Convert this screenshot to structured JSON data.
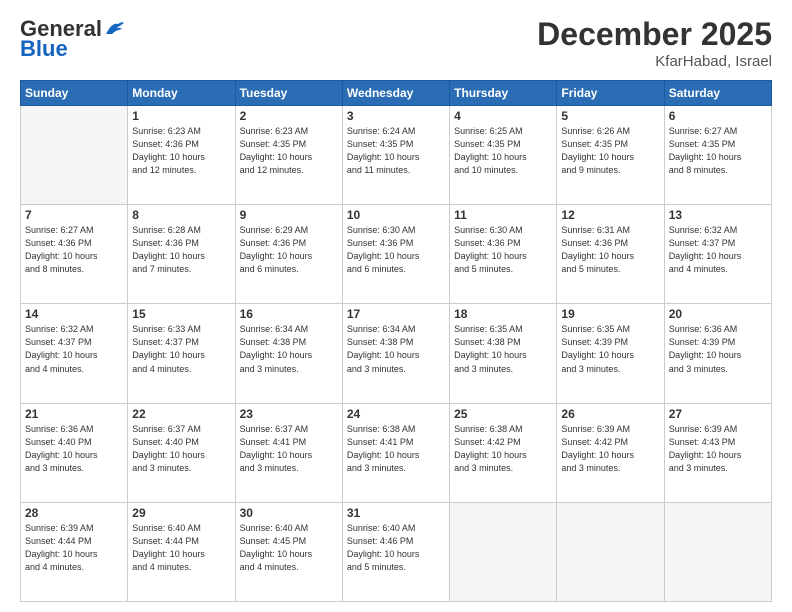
{
  "header": {
    "logo_general": "General",
    "logo_blue": "Blue",
    "month_title": "December 2025",
    "location": "KfarHabad, Israel"
  },
  "weekdays": [
    "Sunday",
    "Monday",
    "Tuesday",
    "Wednesday",
    "Thursday",
    "Friday",
    "Saturday"
  ],
  "weeks": [
    [
      {
        "day": "",
        "info": ""
      },
      {
        "day": "1",
        "info": "Sunrise: 6:23 AM\nSunset: 4:36 PM\nDaylight: 10 hours\nand 12 minutes."
      },
      {
        "day": "2",
        "info": "Sunrise: 6:23 AM\nSunset: 4:35 PM\nDaylight: 10 hours\nand 12 minutes."
      },
      {
        "day": "3",
        "info": "Sunrise: 6:24 AM\nSunset: 4:35 PM\nDaylight: 10 hours\nand 11 minutes."
      },
      {
        "day": "4",
        "info": "Sunrise: 6:25 AM\nSunset: 4:35 PM\nDaylight: 10 hours\nand 10 minutes."
      },
      {
        "day": "5",
        "info": "Sunrise: 6:26 AM\nSunset: 4:35 PM\nDaylight: 10 hours\nand 9 minutes."
      },
      {
        "day": "6",
        "info": "Sunrise: 6:27 AM\nSunset: 4:35 PM\nDaylight: 10 hours\nand 8 minutes."
      }
    ],
    [
      {
        "day": "7",
        "info": "Sunrise: 6:27 AM\nSunset: 4:36 PM\nDaylight: 10 hours\nand 8 minutes."
      },
      {
        "day": "8",
        "info": "Sunrise: 6:28 AM\nSunset: 4:36 PM\nDaylight: 10 hours\nand 7 minutes."
      },
      {
        "day": "9",
        "info": "Sunrise: 6:29 AM\nSunset: 4:36 PM\nDaylight: 10 hours\nand 6 minutes."
      },
      {
        "day": "10",
        "info": "Sunrise: 6:30 AM\nSunset: 4:36 PM\nDaylight: 10 hours\nand 6 minutes."
      },
      {
        "day": "11",
        "info": "Sunrise: 6:30 AM\nSunset: 4:36 PM\nDaylight: 10 hours\nand 5 minutes."
      },
      {
        "day": "12",
        "info": "Sunrise: 6:31 AM\nSunset: 4:36 PM\nDaylight: 10 hours\nand 5 minutes."
      },
      {
        "day": "13",
        "info": "Sunrise: 6:32 AM\nSunset: 4:37 PM\nDaylight: 10 hours\nand 4 minutes."
      }
    ],
    [
      {
        "day": "14",
        "info": "Sunrise: 6:32 AM\nSunset: 4:37 PM\nDaylight: 10 hours\nand 4 minutes."
      },
      {
        "day": "15",
        "info": "Sunrise: 6:33 AM\nSunset: 4:37 PM\nDaylight: 10 hours\nand 4 minutes."
      },
      {
        "day": "16",
        "info": "Sunrise: 6:34 AM\nSunset: 4:38 PM\nDaylight: 10 hours\nand 3 minutes."
      },
      {
        "day": "17",
        "info": "Sunrise: 6:34 AM\nSunset: 4:38 PM\nDaylight: 10 hours\nand 3 minutes."
      },
      {
        "day": "18",
        "info": "Sunrise: 6:35 AM\nSunset: 4:38 PM\nDaylight: 10 hours\nand 3 minutes."
      },
      {
        "day": "19",
        "info": "Sunrise: 6:35 AM\nSunset: 4:39 PM\nDaylight: 10 hours\nand 3 minutes."
      },
      {
        "day": "20",
        "info": "Sunrise: 6:36 AM\nSunset: 4:39 PM\nDaylight: 10 hours\nand 3 minutes."
      }
    ],
    [
      {
        "day": "21",
        "info": "Sunrise: 6:36 AM\nSunset: 4:40 PM\nDaylight: 10 hours\nand 3 minutes."
      },
      {
        "day": "22",
        "info": "Sunrise: 6:37 AM\nSunset: 4:40 PM\nDaylight: 10 hours\nand 3 minutes."
      },
      {
        "day": "23",
        "info": "Sunrise: 6:37 AM\nSunset: 4:41 PM\nDaylight: 10 hours\nand 3 minutes."
      },
      {
        "day": "24",
        "info": "Sunrise: 6:38 AM\nSunset: 4:41 PM\nDaylight: 10 hours\nand 3 minutes."
      },
      {
        "day": "25",
        "info": "Sunrise: 6:38 AM\nSunset: 4:42 PM\nDaylight: 10 hours\nand 3 minutes."
      },
      {
        "day": "26",
        "info": "Sunrise: 6:39 AM\nSunset: 4:42 PM\nDaylight: 10 hours\nand 3 minutes."
      },
      {
        "day": "27",
        "info": "Sunrise: 6:39 AM\nSunset: 4:43 PM\nDaylight: 10 hours\nand 3 minutes."
      }
    ],
    [
      {
        "day": "28",
        "info": "Sunrise: 6:39 AM\nSunset: 4:44 PM\nDaylight: 10 hours\nand 4 minutes."
      },
      {
        "day": "29",
        "info": "Sunrise: 6:40 AM\nSunset: 4:44 PM\nDaylight: 10 hours\nand 4 minutes."
      },
      {
        "day": "30",
        "info": "Sunrise: 6:40 AM\nSunset: 4:45 PM\nDaylight: 10 hours\nand 4 minutes."
      },
      {
        "day": "31",
        "info": "Sunrise: 6:40 AM\nSunset: 4:46 PM\nDaylight: 10 hours\nand 5 minutes."
      },
      {
        "day": "",
        "info": ""
      },
      {
        "day": "",
        "info": ""
      },
      {
        "day": "",
        "info": ""
      }
    ]
  ]
}
